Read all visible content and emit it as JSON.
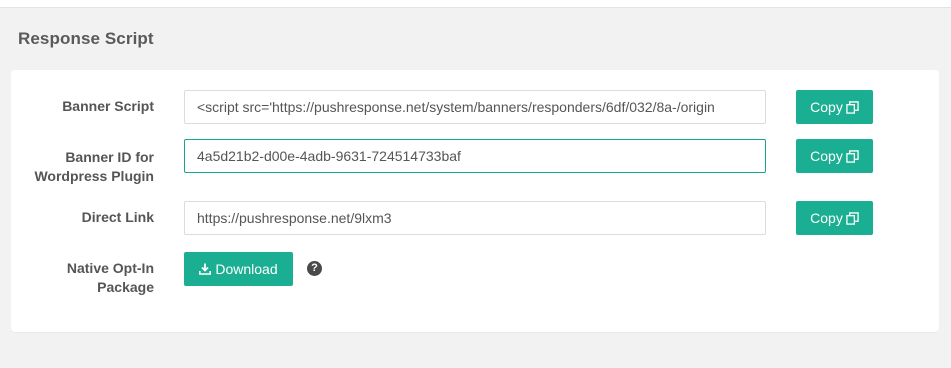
{
  "panel": {
    "title": "Response Script"
  },
  "rows": {
    "banner_script": {
      "label": "Banner Script",
      "value": "<script src='https://pushresponse.net/system/banners/responders/6df/032/8a-/origin",
      "copy_label": "Copy"
    },
    "banner_id": {
      "label_line1": "Banner ID for",
      "label_line2": "Wordpress Plugin",
      "value": "4a5d21b2-d00e-4adb-9631-724514733baf",
      "copy_label": "Copy"
    },
    "direct_link": {
      "label": "Direct Link",
      "value": "https://pushresponse.net/9lxm3",
      "copy_label": "Copy"
    },
    "native_optin": {
      "label_line1": "Native Opt-In",
      "label_line2": "Package",
      "download_label": "Download",
      "help_glyph": "?"
    }
  },
  "icons": {
    "copy": "copy-icon",
    "download": "download-icon",
    "help": "question-circle-icon"
  },
  "colors": {
    "accent": "#1aaf93",
    "focus_border": "#17a589",
    "page_bg": "#f2f2f2",
    "panel_bg": "#ffffff"
  }
}
